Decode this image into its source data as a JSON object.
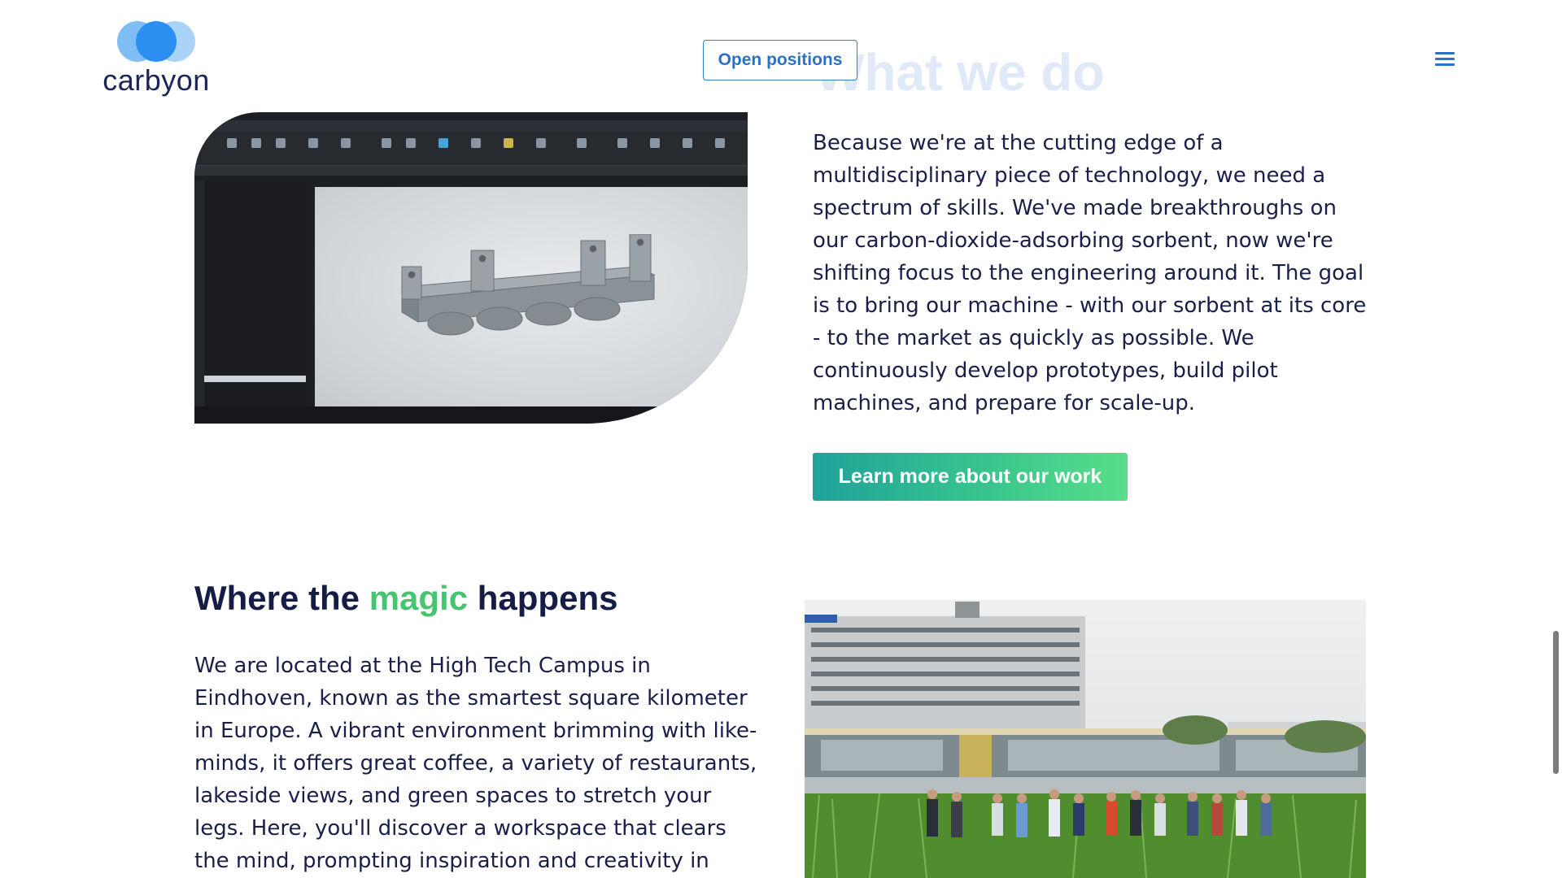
{
  "header": {
    "logo_text": "carbyon",
    "open_positions_label": "Open positions",
    "ghost_heading": "What we do",
    "menu_icon": "hamburger-menu-icon"
  },
  "what_we_do": {
    "paragraph": "Because we're at the cutting edge of a multidisciplinary piece of technology, we need a spectrum of skills. We've made breakthroughs on our carbon-dioxide-adsorbing sorbent, now we're shifting focus to the engineering around it. The goal is to bring our machine - with our sorbent at its core - to the market as quickly as possible. We continuously develop prototypes, build pilot machines, and prepare for scale-up.",
    "cta_label": "Learn more about our work",
    "image_alt": "CAD software screenshot showing a 3D mechanical part"
  },
  "where_magic": {
    "heading_before": "Where the ",
    "heading_accent": "magic",
    "heading_after": " happens",
    "paragraph": "We are located at the High Tech Campus in Eindhoven, known as the smartest square kilometer in Europe. A vibrant environment brimming with like-minds, it offers great coffee, a variety of restaurants, lakeside views, and green spaces to stretch your legs. Here, you'll discover a workspace that clears the mind, prompting inspiration and creativity in every",
    "image_alt": "Team walking through tall grass in front of the High Tech Campus building"
  },
  "colors": {
    "navy": "#151d47",
    "accent_green": "#46c46f",
    "button_blue": "#2a72c6",
    "cta_gradient_start": "#1fa29a",
    "cta_gradient_end": "#58de8a"
  }
}
